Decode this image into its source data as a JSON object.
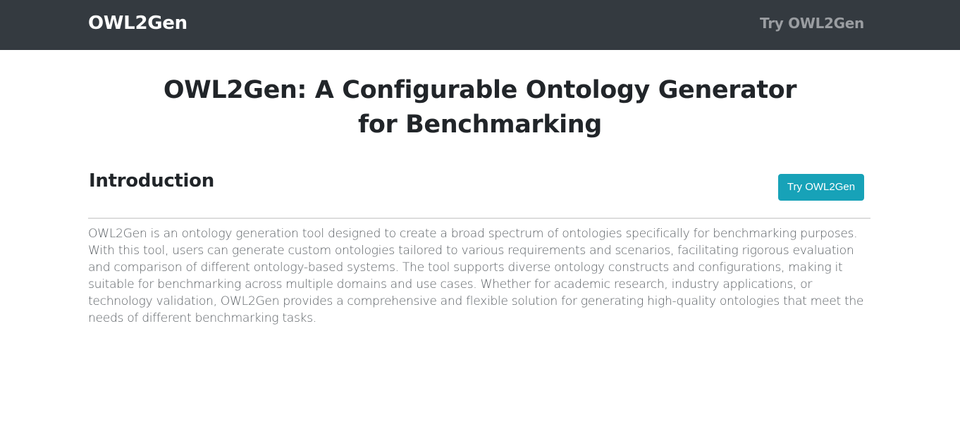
{
  "navbar": {
    "brand": "OWL2Gen",
    "link": "Try OWL2Gen"
  },
  "main": {
    "title": "OWL2Gen: A Configurable Ontology Generator for Benchmarking",
    "section": {
      "heading": "Introduction",
      "button_label": "Try OWL2Gen",
      "paragraph": "OWL2Gen is an ontology generation tool designed to create a broad spectrum of ontologies specifically for benchmarking purposes. With this tool, users can generate custom ontologies tailored to various requirements and scenarios, facilitating rigorous evaluation and comparison of different ontology-based systems. The tool supports diverse ontology constructs and configurations, making it suitable for benchmarking across multiple domains and use cases. Whether for academic research, industry applications, or technology validation, OWL2Gen provides a comprehensive and flexible solution for generating high-quality ontologies that meet the needs of different benchmarking tasks."
    }
  },
  "colors": {
    "navbar_bg": "#343a40",
    "button_bg": "#17a2b8"
  }
}
